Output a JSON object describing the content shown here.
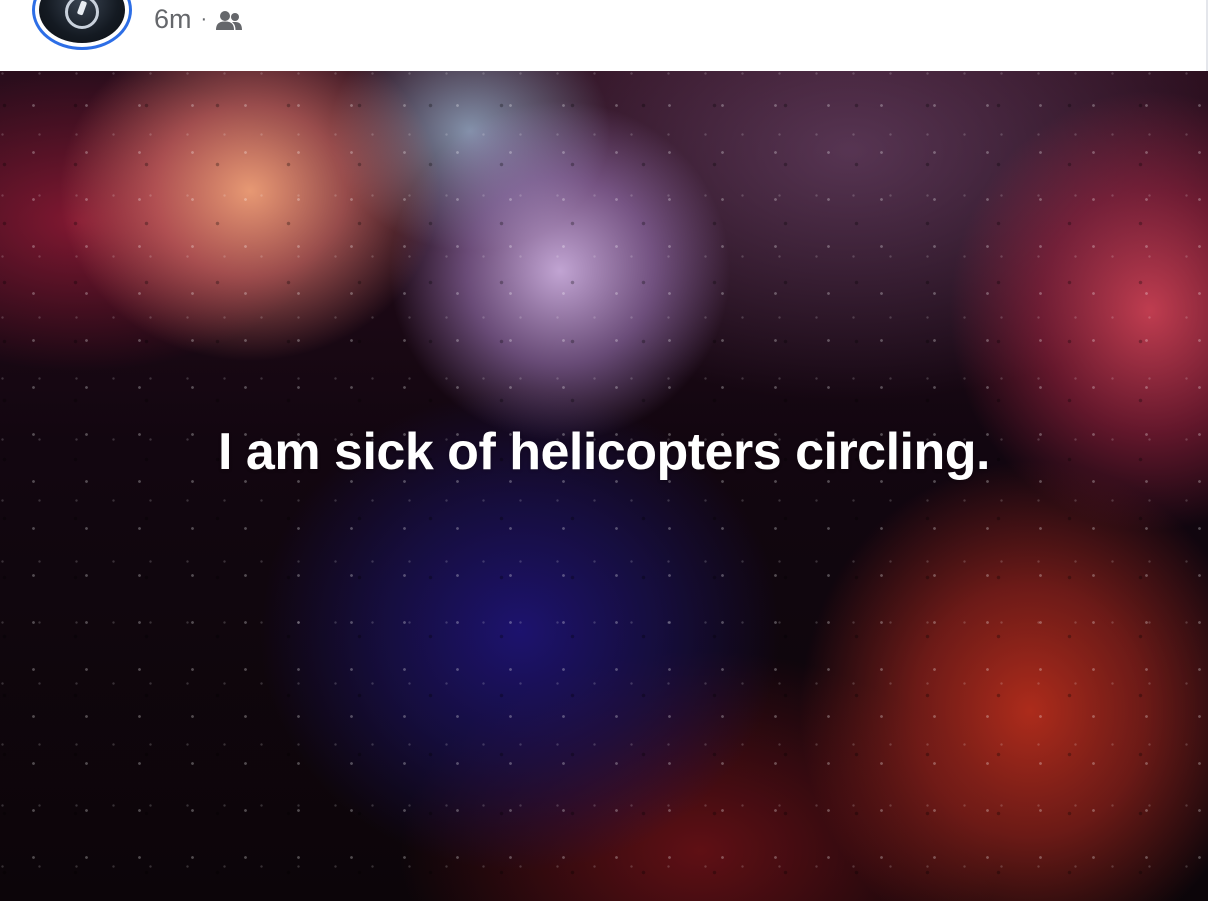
{
  "post": {
    "timestamp": "6m",
    "separator": "·",
    "audience_icon": "friends-icon",
    "text": "I am sick of helicopters circling."
  },
  "colors": {
    "avatar_ring": "#2d6ee6",
    "meta_text": "#65676b",
    "post_text": "#ffffff"
  }
}
